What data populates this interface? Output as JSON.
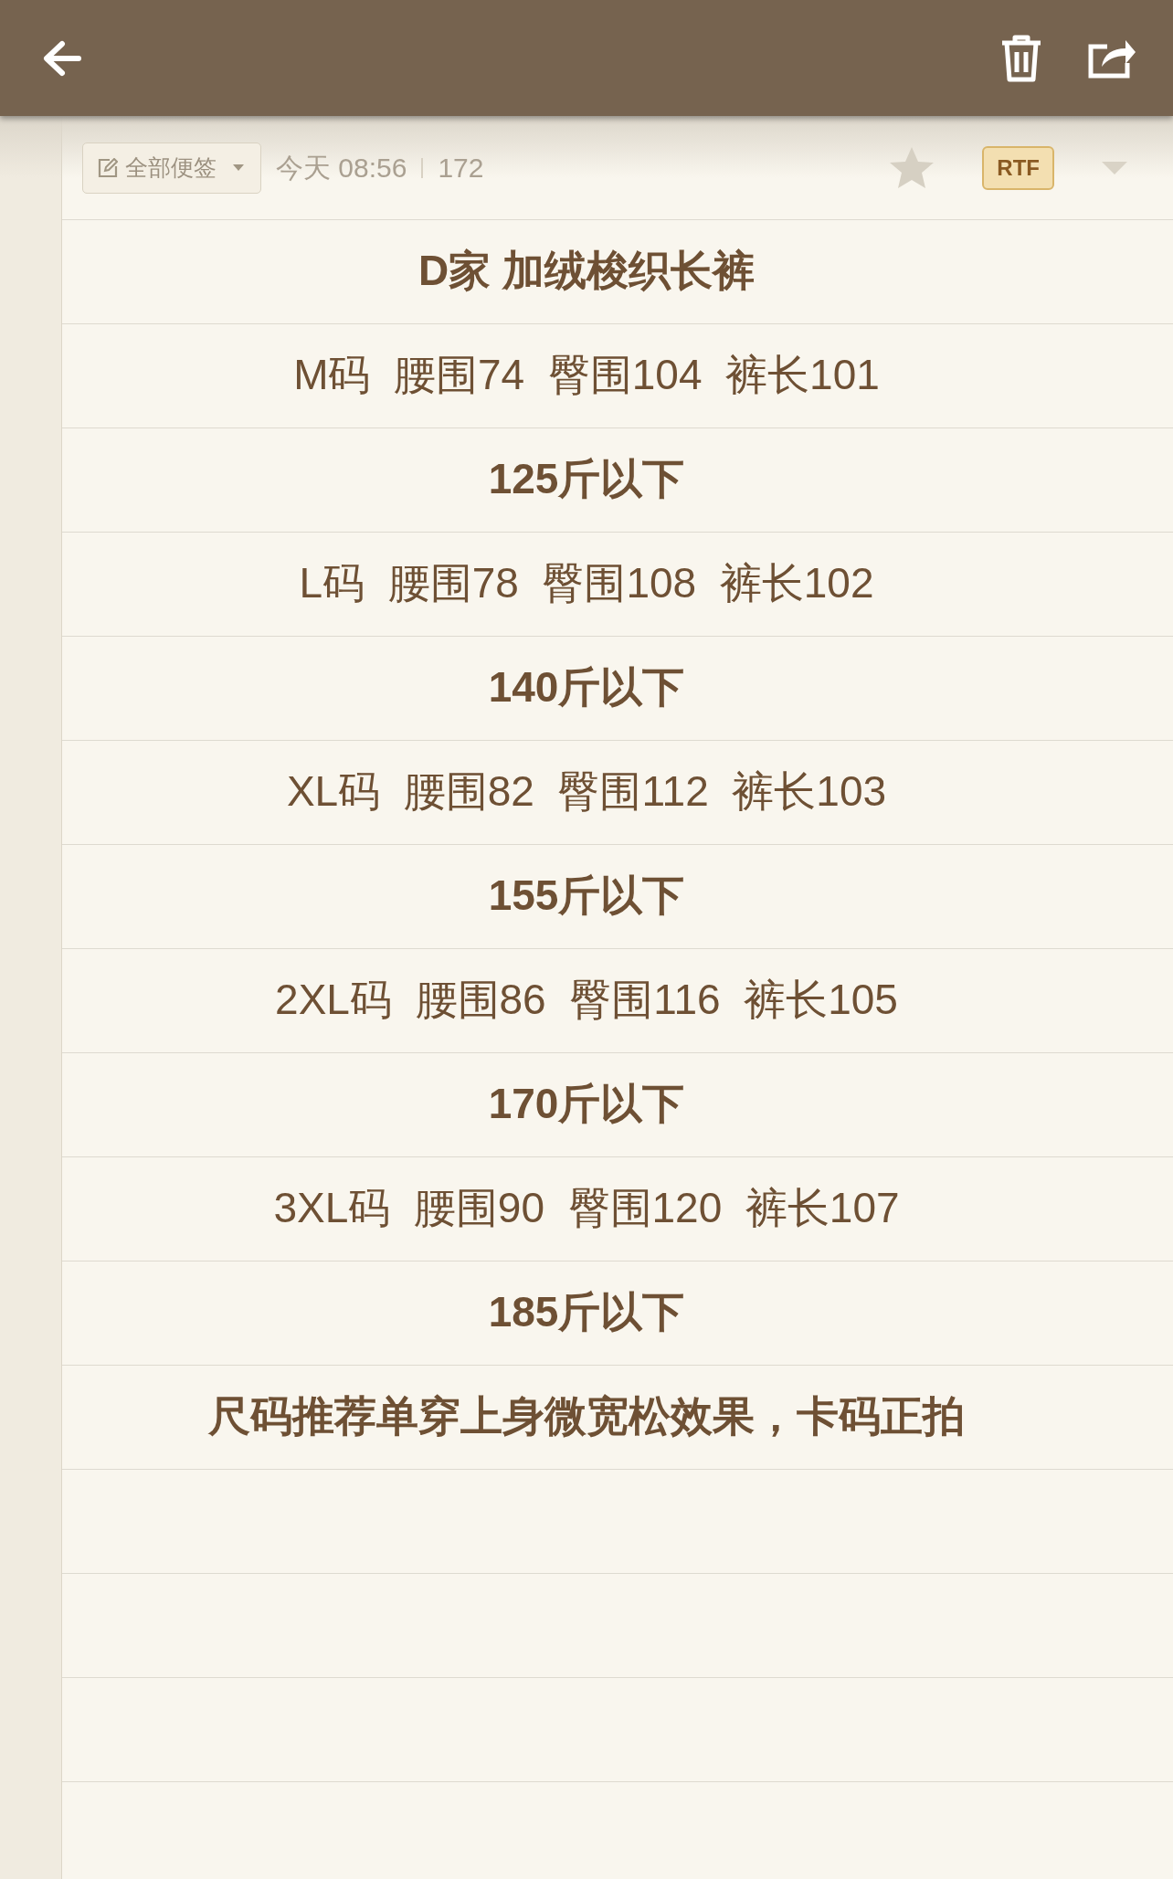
{
  "header": {
    "actions": [
      {
        "kind": "back"
      },
      {
        "kind": "delete"
      },
      {
        "kind": "share"
      }
    ]
  },
  "info_bar": {
    "folder": "全部便签",
    "date": "今天 08:56",
    "count": "172",
    "starred": false,
    "format": "RTF"
  },
  "lines": [
    {
      "text": "D家 加绒梭织长裤",
      "bold": true
    },
    {
      "text": "M码  腰围74  臀围104  裤长101",
      "bold": false
    },
    {
      "text": "125斤以下",
      "bold": true
    },
    {
      "text": "L码  腰围78  臀围108  裤长102",
      "bold": false
    },
    {
      "text": "140斤以下",
      "bold": true
    },
    {
      "text": "XL码  腰围82  臀围112  裤长103",
      "bold": false
    },
    {
      "text": "155斤以下",
      "bold": true
    },
    {
      "text": "2XL码  腰围86  臀围116  裤长105",
      "bold": false
    },
    {
      "text": "170斤以下",
      "bold": true
    },
    {
      "text": "3XL码  腰围90  臀围120  裤长107",
      "bold": false
    },
    {
      "text": "185斤以下",
      "bold": true
    },
    {
      "text": "尺码推荐单穿上身微宽松效果，卡码正拍",
      "bold": true
    }
  ]
}
